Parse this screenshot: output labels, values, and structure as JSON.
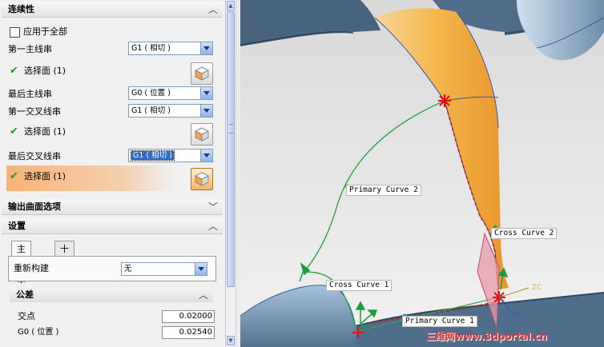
{
  "dialog": {
    "continuity_section": {
      "title": "连续性",
      "apply_all_label": "应用于全部",
      "first_primary_label": "第一主线串",
      "first_primary_value": "G1 ( 相切 )",
      "select_face_1": "选择面 (1)",
      "last_primary_label": "最后主线串",
      "last_primary_value": "G0 ( 位置 )",
      "first_cross_label": "第一交叉线串",
      "first_cross_value": "G1 ( 相切 )",
      "select_face_2": "选择面 (1)",
      "last_cross_label": "最后交叉线串",
      "last_cross_value": "G1 ( 相切 )",
      "select_face_3": "选择面 (1)"
    },
    "output_section": {
      "title": "输出曲面选项"
    },
    "settings_section": {
      "title": "设置",
      "tabs": [
        "主线串",
        "十字"
      ],
      "rebuild_label": "重新构建",
      "rebuild_value": "无"
    },
    "tolerance_section": {
      "title": "公差",
      "intersection_label": "交点",
      "intersection_value": "0.02000",
      "g0_label": "G0 ( 位置 )",
      "g0_value": "0.02540"
    },
    "icons": {
      "collapse": "chevron-up-icon",
      "expand": "chevron-down-icon",
      "check": "check-icon",
      "face_select": "face-cube-icon"
    }
  },
  "viewport": {
    "curve_labels": {
      "primary_2": "Primary Curve  2",
      "primary_1": "Primary Curve  1",
      "cross_1": "Cross Curve  1",
      "cross_2": "Cross Curve  2"
    },
    "axis_labels": {
      "zc": "ZC",
      "yc": "YC"
    },
    "watermark": "三维网www.3dportal.cn",
    "colors": {
      "orange_surface": "#f5b04a",
      "blue_surface": "#4f6f8f",
      "curve_green": "#3aa34a",
      "marker_red": "#e01010"
    }
  }
}
